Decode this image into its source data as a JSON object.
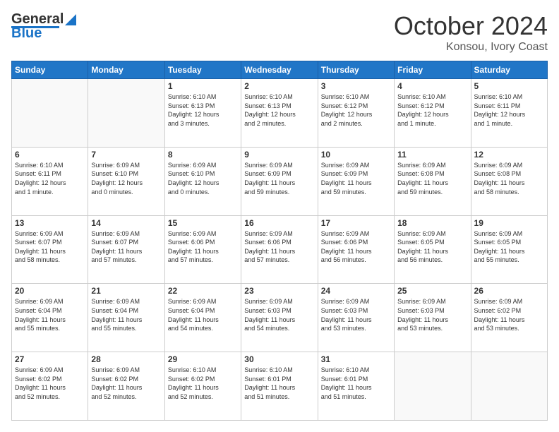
{
  "header": {
    "logo": {
      "general": "General",
      "blue": "Blue"
    },
    "title": "October 2024",
    "location": "Konsou, Ivory Coast"
  },
  "calendar": {
    "headers": [
      "Sunday",
      "Monday",
      "Tuesday",
      "Wednesday",
      "Thursday",
      "Friday",
      "Saturday"
    ],
    "weeks": [
      [
        {
          "day": "",
          "info": ""
        },
        {
          "day": "",
          "info": ""
        },
        {
          "day": "1",
          "info": "Sunrise: 6:10 AM\nSunset: 6:13 PM\nDaylight: 12 hours\nand 3 minutes."
        },
        {
          "day": "2",
          "info": "Sunrise: 6:10 AM\nSunset: 6:13 PM\nDaylight: 12 hours\nand 2 minutes."
        },
        {
          "day": "3",
          "info": "Sunrise: 6:10 AM\nSunset: 6:12 PM\nDaylight: 12 hours\nand 2 minutes."
        },
        {
          "day": "4",
          "info": "Sunrise: 6:10 AM\nSunset: 6:12 PM\nDaylight: 12 hours\nand 1 minute."
        },
        {
          "day": "5",
          "info": "Sunrise: 6:10 AM\nSunset: 6:11 PM\nDaylight: 12 hours\nand 1 minute."
        }
      ],
      [
        {
          "day": "6",
          "info": "Sunrise: 6:10 AM\nSunset: 6:11 PM\nDaylight: 12 hours\nand 1 minute."
        },
        {
          "day": "7",
          "info": "Sunrise: 6:09 AM\nSunset: 6:10 PM\nDaylight: 12 hours\nand 0 minutes."
        },
        {
          "day": "8",
          "info": "Sunrise: 6:09 AM\nSunset: 6:10 PM\nDaylight: 12 hours\nand 0 minutes."
        },
        {
          "day": "9",
          "info": "Sunrise: 6:09 AM\nSunset: 6:09 PM\nDaylight: 11 hours\nand 59 minutes."
        },
        {
          "day": "10",
          "info": "Sunrise: 6:09 AM\nSunset: 6:09 PM\nDaylight: 11 hours\nand 59 minutes."
        },
        {
          "day": "11",
          "info": "Sunrise: 6:09 AM\nSunset: 6:08 PM\nDaylight: 11 hours\nand 59 minutes."
        },
        {
          "day": "12",
          "info": "Sunrise: 6:09 AM\nSunset: 6:08 PM\nDaylight: 11 hours\nand 58 minutes."
        }
      ],
      [
        {
          "day": "13",
          "info": "Sunrise: 6:09 AM\nSunset: 6:07 PM\nDaylight: 11 hours\nand 58 minutes."
        },
        {
          "day": "14",
          "info": "Sunrise: 6:09 AM\nSunset: 6:07 PM\nDaylight: 11 hours\nand 57 minutes."
        },
        {
          "day": "15",
          "info": "Sunrise: 6:09 AM\nSunset: 6:06 PM\nDaylight: 11 hours\nand 57 minutes."
        },
        {
          "day": "16",
          "info": "Sunrise: 6:09 AM\nSunset: 6:06 PM\nDaylight: 11 hours\nand 57 minutes."
        },
        {
          "day": "17",
          "info": "Sunrise: 6:09 AM\nSunset: 6:06 PM\nDaylight: 11 hours\nand 56 minutes."
        },
        {
          "day": "18",
          "info": "Sunrise: 6:09 AM\nSunset: 6:05 PM\nDaylight: 11 hours\nand 56 minutes."
        },
        {
          "day": "19",
          "info": "Sunrise: 6:09 AM\nSunset: 6:05 PM\nDaylight: 11 hours\nand 55 minutes."
        }
      ],
      [
        {
          "day": "20",
          "info": "Sunrise: 6:09 AM\nSunset: 6:04 PM\nDaylight: 11 hours\nand 55 minutes."
        },
        {
          "day": "21",
          "info": "Sunrise: 6:09 AM\nSunset: 6:04 PM\nDaylight: 11 hours\nand 55 minutes."
        },
        {
          "day": "22",
          "info": "Sunrise: 6:09 AM\nSunset: 6:04 PM\nDaylight: 11 hours\nand 54 minutes."
        },
        {
          "day": "23",
          "info": "Sunrise: 6:09 AM\nSunset: 6:03 PM\nDaylight: 11 hours\nand 54 minutes."
        },
        {
          "day": "24",
          "info": "Sunrise: 6:09 AM\nSunset: 6:03 PM\nDaylight: 11 hours\nand 53 minutes."
        },
        {
          "day": "25",
          "info": "Sunrise: 6:09 AM\nSunset: 6:03 PM\nDaylight: 11 hours\nand 53 minutes."
        },
        {
          "day": "26",
          "info": "Sunrise: 6:09 AM\nSunset: 6:02 PM\nDaylight: 11 hours\nand 53 minutes."
        }
      ],
      [
        {
          "day": "27",
          "info": "Sunrise: 6:09 AM\nSunset: 6:02 PM\nDaylight: 11 hours\nand 52 minutes."
        },
        {
          "day": "28",
          "info": "Sunrise: 6:09 AM\nSunset: 6:02 PM\nDaylight: 11 hours\nand 52 minutes."
        },
        {
          "day": "29",
          "info": "Sunrise: 6:10 AM\nSunset: 6:02 PM\nDaylight: 11 hours\nand 52 minutes."
        },
        {
          "day": "30",
          "info": "Sunrise: 6:10 AM\nSunset: 6:01 PM\nDaylight: 11 hours\nand 51 minutes."
        },
        {
          "day": "31",
          "info": "Sunrise: 6:10 AM\nSunset: 6:01 PM\nDaylight: 11 hours\nand 51 minutes."
        },
        {
          "day": "",
          "info": ""
        },
        {
          "day": "",
          "info": ""
        }
      ]
    ]
  }
}
